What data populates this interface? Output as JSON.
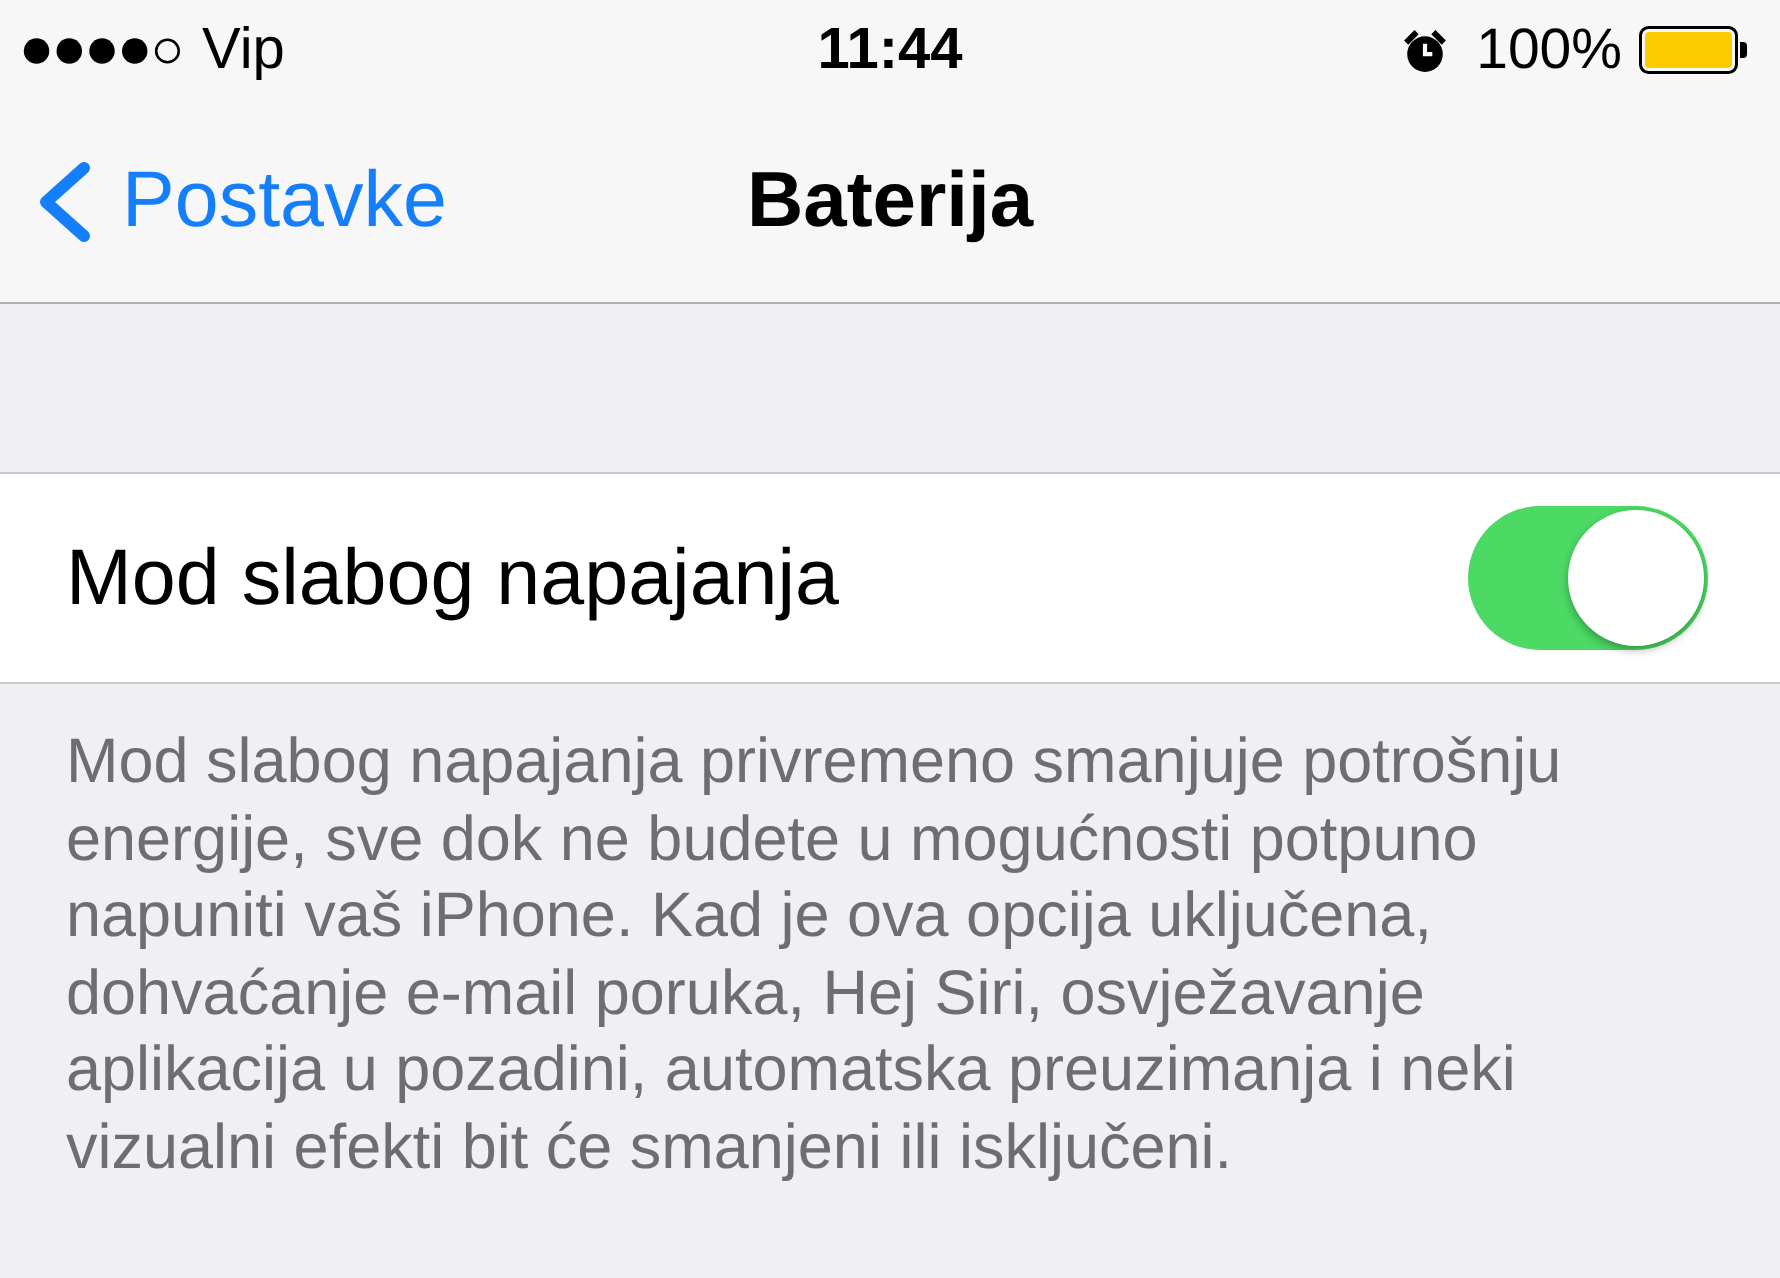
{
  "status_bar": {
    "carrier": "Vip",
    "time": "11:44",
    "battery_percent": "100%"
  },
  "nav_bar": {
    "back_label": "Postavke",
    "title": "Baterija"
  },
  "settings": [
    {
      "kind": "toggle",
      "label": "Mod slabog napajanja",
      "on": true
    }
  ],
  "footer": "Mod slabog napajanja privremeno smanjuje potrošnju energije, sve dok ne budete u mogućnosti potpuno napuniti vaš iPhone. Kad je ova opcija uključena, dohvaćanje e-mail poruka, Hej Siri, osvježavanje aplikacija u pozadini, automatska preuzimanja i neki vizualni efekti bit će smanjeni ili isključeni."
}
